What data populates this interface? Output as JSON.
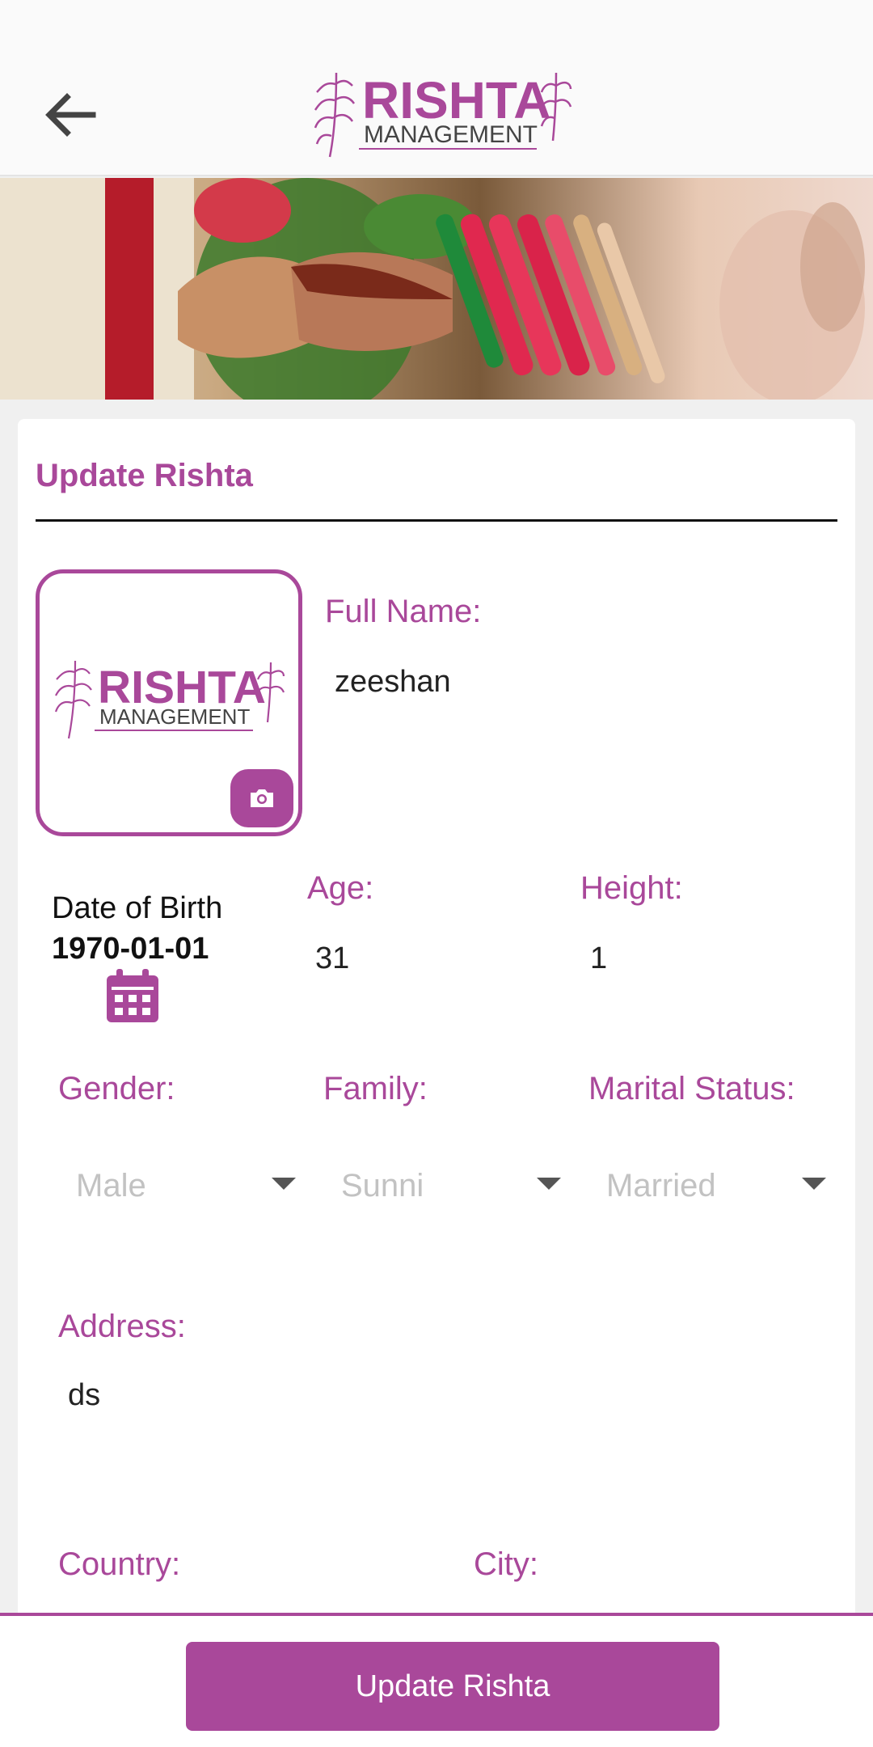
{
  "header": {
    "back_icon": "arrow-left-icon",
    "logo": {
      "main": "RISHTA",
      "sub": "MANAGEMENT"
    }
  },
  "banner": {
    "description_icon": "wedding-hands-banner"
  },
  "form": {
    "title": "Update Rishta",
    "photo": {
      "logo_main": "RISHTA",
      "logo_sub": "MANAGEMENT",
      "camera_icon": "camera-icon"
    },
    "full_name": {
      "label": "Full Name:",
      "value": "zeeshan"
    },
    "dob": {
      "label": "Date of Birth",
      "value": "1970-01-01",
      "icon": "calendar-icon"
    },
    "age": {
      "label": "Age:",
      "value": "31"
    },
    "height": {
      "label": "Height:",
      "value": "1"
    },
    "gender": {
      "label": "Gender:",
      "value": "Male"
    },
    "family": {
      "label": "Family:",
      "value": "Sunni"
    },
    "marital_status": {
      "label": "Marital Status:",
      "value": "Married"
    },
    "address": {
      "label": "Address:",
      "value": "ds"
    },
    "country": {
      "label": "Country:"
    },
    "city": {
      "label": "City:"
    }
  },
  "footer": {
    "update_label": "Update Rishta"
  },
  "colors": {
    "accent": "#a9489a",
    "placeholder": "#c2c2c2",
    "text": "#222222"
  }
}
